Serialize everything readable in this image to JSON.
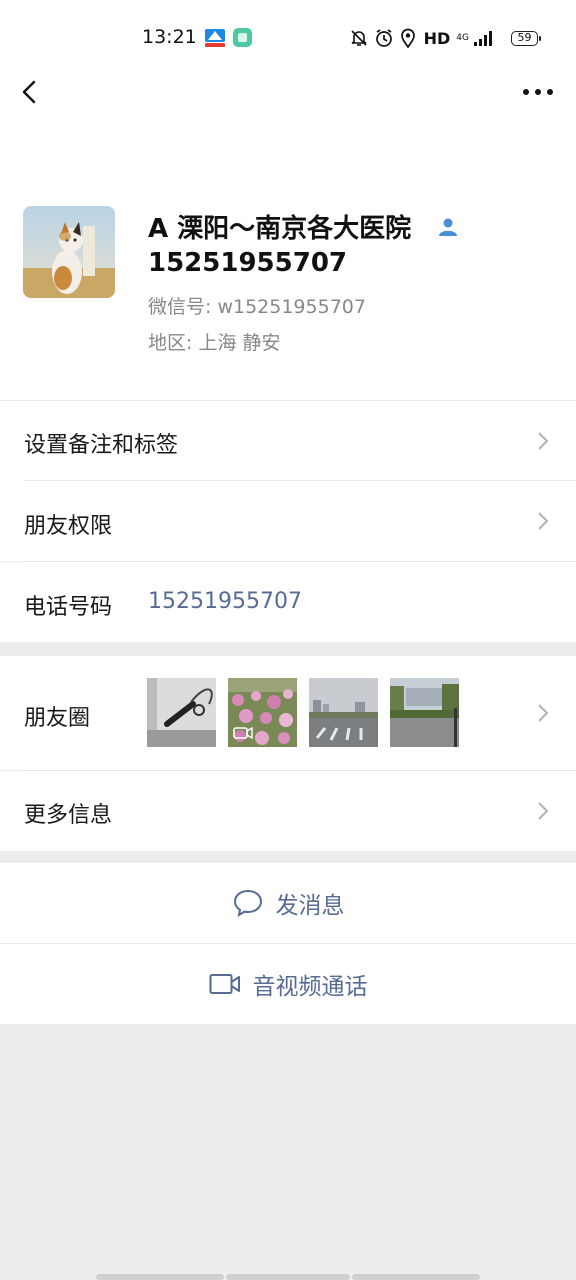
{
  "status_bar": {
    "time": "13:21",
    "hd": "HD",
    "network": "4G",
    "battery": "59",
    "icons": [
      "mute-icon",
      "alarm-icon",
      "location-icon",
      "signal-icon"
    ]
  },
  "nav": {
    "back_icon": "chevron-left-icon",
    "more_icon": "more-dots-icon"
  },
  "profile": {
    "name": "A 溧阳～南京各大医院",
    "phone_title": "15251955707",
    "wechat_id": "微信号: w15251955707",
    "region": "地区: 上海  静安"
  },
  "rows": {
    "remark": "设置备注和标签",
    "permissions": "朋友权限",
    "phone_label": "电话号码",
    "phone_value": "15251955707",
    "moments": "朋友圈",
    "more_info": "更多信息"
  },
  "actions": {
    "message": "发消息",
    "call": "音视频通话"
  },
  "colors": {
    "link": "#576b95",
    "background": "#ededed",
    "card": "#ffffff",
    "secondary_text": "#888888"
  }
}
